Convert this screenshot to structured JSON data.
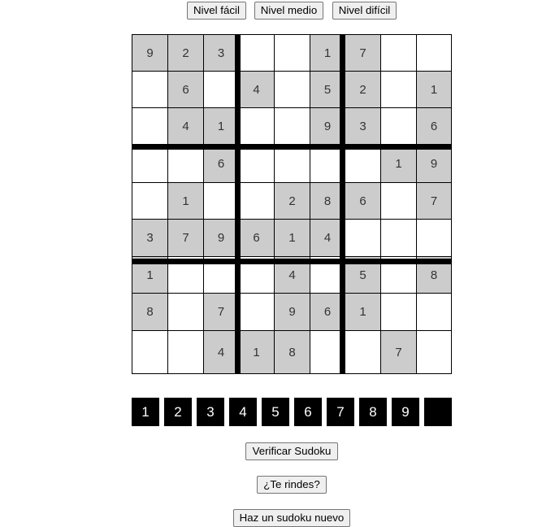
{
  "difficulty": {
    "easy_label": "Nivel fácil",
    "medium_label": "Nivel medio",
    "hard_label": "Nivel difícil"
  },
  "board": {
    "rows": [
      [
        "9",
        "2",
        "3",
        "",
        "",
        "1",
        "7",
        "",
        ""
      ],
      [
        "",
        "6",
        "",
        "4",
        "",
        "5",
        "2",
        "",
        "1"
      ],
      [
        "",
        "4",
        "1",
        "",
        "",
        "9",
        "3",
        "",
        "6"
      ],
      [
        "",
        "",
        "6",
        "",
        "",
        "",
        "",
        "1",
        "9"
      ],
      [
        "",
        "1",
        "",
        "",
        "2",
        "8",
        "6",
        "",
        "7"
      ],
      [
        "3",
        "7",
        "9",
        "6",
        "1",
        "4",
        "",
        "",
        ""
      ],
      [
        "1",
        "",
        "",
        "",
        "4",
        "",
        "5",
        "",
        "8"
      ],
      [
        "8",
        "",
        "7",
        "",
        "9",
        "6",
        "1",
        "",
        ""
      ],
      [
        "",
        "",
        "4",
        "1",
        "8",
        "",
        "",
        "7",
        ""
      ]
    ],
    "given": [
      [
        true,
        true,
        true,
        false,
        false,
        true,
        true,
        false,
        false
      ],
      [
        false,
        true,
        false,
        true,
        false,
        true,
        true,
        false,
        true
      ],
      [
        false,
        true,
        true,
        false,
        false,
        true,
        true,
        false,
        true
      ],
      [
        false,
        false,
        true,
        false,
        false,
        false,
        false,
        true,
        true
      ],
      [
        false,
        true,
        false,
        false,
        true,
        true,
        true,
        false,
        true
      ],
      [
        true,
        true,
        true,
        true,
        true,
        true,
        false,
        false,
        false
      ],
      [
        true,
        false,
        false,
        false,
        true,
        false,
        true,
        false,
        true
      ],
      [
        true,
        false,
        true,
        false,
        true,
        true,
        true,
        false,
        false
      ],
      [
        false,
        false,
        true,
        true,
        true,
        false,
        false,
        true,
        false
      ]
    ]
  },
  "numpad": {
    "keys": [
      "1",
      "2",
      "3",
      "4",
      "5",
      "6",
      "7",
      "8",
      "9",
      ""
    ]
  },
  "actions": {
    "verify_label": "Verificar Sudoku",
    "giveup_label": "¿Te rindes?",
    "new_label": "Haz un sudoku nuevo"
  },
  "colors": {
    "given_cell": "#cccccc",
    "empty_cell": "#ffffff",
    "grid_line": "#000000",
    "numpad_bg": "#000000",
    "numpad_text": "#ffffff"
  }
}
